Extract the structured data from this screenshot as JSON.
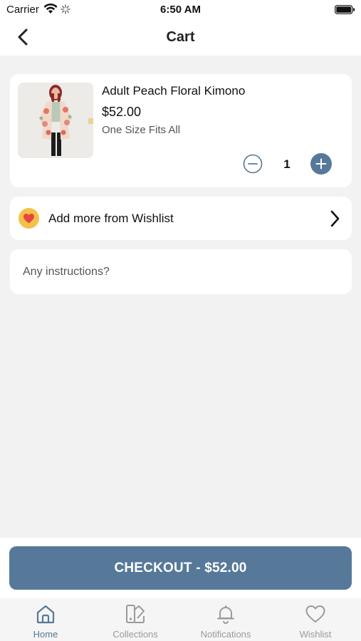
{
  "status_bar": {
    "carrier": "Carrier",
    "time": "6:50 AM"
  },
  "nav": {
    "title": "Cart",
    "back_icon": "chevron-left-icon"
  },
  "cart_item": {
    "name": "Adult Peach Floral Kimono",
    "price": "$52.00",
    "variant": "One Size Fits All",
    "quantity": "1"
  },
  "wishlist_row": {
    "label": "Add more from Wishlist",
    "icon": "heart-icon",
    "badge_color": "#f5c04a",
    "heart_color": "#e3473f"
  },
  "instructions": {
    "placeholder": "Any instructions?",
    "value": ""
  },
  "checkout": {
    "label": "CHECKOUT - $52.00",
    "color": "#567999"
  },
  "tabs": [
    {
      "label": "Home",
      "icon": "home-icon",
      "active": true
    },
    {
      "label": "Collections",
      "icon": "collections-icon",
      "active": false
    },
    {
      "label": "Notifications",
      "icon": "bell-icon",
      "active": false
    },
    {
      "label": "Wishlist",
      "icon": "heart-outline-icon",
      "active": false
    }
  ],
  "colors": {
    "accent": "#567999",
    "background": "#f2f2f2",
    "tab_inactive": "#9a9a9a"
  }
}
